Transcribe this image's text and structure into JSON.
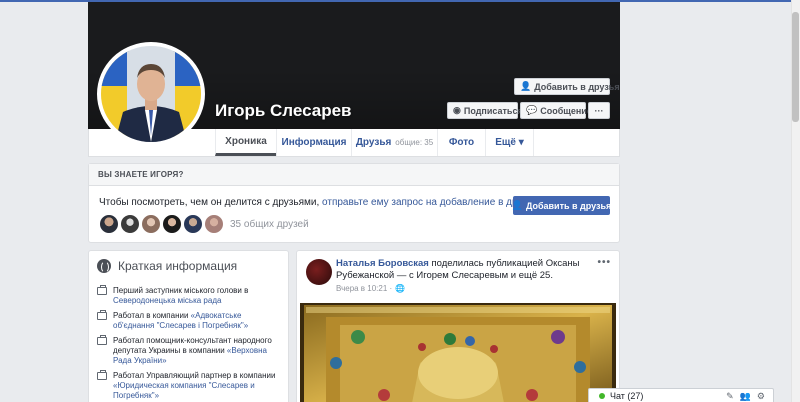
{
  "profile": {
    "name": "Игорь Слесарев",
    "add_friend": "Добавить в друзья",
    "follow": "Подписаться",
    "message": "Сообщение",
    "more": "···"
  },
  "tabs": [
    {
      "label": "Хроника"
    },
    {
      "label": "Информация"
    },
    {
      "label": "Друзья",
      "count": "общие: 35"
    },
    {
      "label": "Фото"
    },
    {
      "label": "Ещё ▾"
    }
  ],
  "know": {
    "title": "ВЫ ЗНАЕТЕ ИГОРЯ?",
    "text": "Чтобы посмотреть, чем он делится с друзьями, ",
    "link": "отправьте ему запрос на добавление в друзья.",
    "button": "Добавить в друзья",
    "mutual_count": "35 общих друзей"
  },
  "intro": {
    "title": "Краткая информация",
    "items": [
      {
        "pre": "Перший заступник міського голови в ",
        "link": "Северодонецька міська рада",
        "post": ""
      },
      {
        "pre": "Работал в компании ",
        "link": "«Адвокатське об'єднання \"Слесарев і Погребняк\"»",
        "post": ""
      },
      {
        "pre": "Работал помощник-консультант народного депутата Украины в компании ",
        "link": "«Верховна Рада України»",
        "post": ""
      },
      {
        "pre": "Работал Управляющий партнер в компании ",
        "link": "«Юридическая компания \"Слесарев и Погребняк\"»",
        "post": ""
      }
    ]
  },
  "post": {
    "author": "Наталья Боровская",
    "text": " поделилась публикацией Оксаны Рубежанской — с Игорем Слесаревым и ещё 25.",
    "time": "Вчера в 10:21 ·",
    "menu": "•••"
  },
  "chat": {
    "label": "Чат (27)"
  },
  "colors": {
    "brand": "#4267b2",
    "link": "#365899",
    "online": "#42b72a"
  }
}
